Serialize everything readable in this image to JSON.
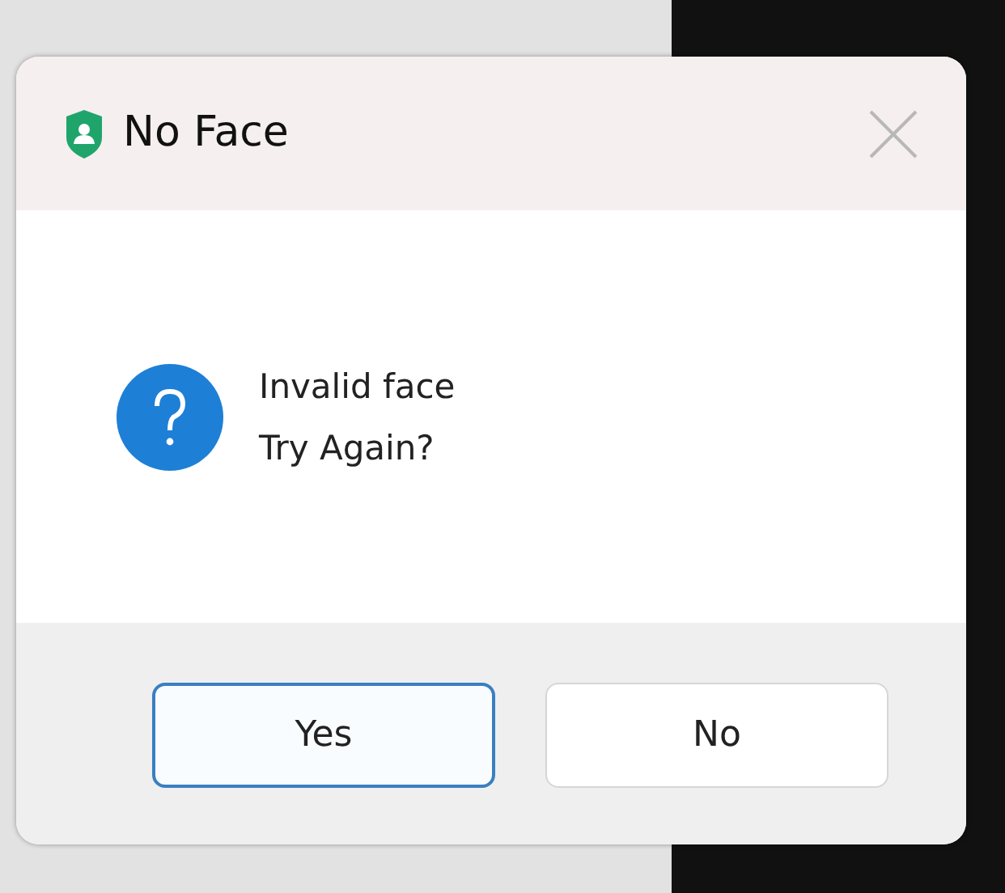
{
  "window": {
    "title": "No Face"
  },
  "message_lines": [
    "Invalid face",
    "Try Again?"
  ],
  "buttons": [
    {
      "label": "Yes",
      "focused": true
    },
    {
      "label": "No",
      "focused": false
    }
  ]
}
